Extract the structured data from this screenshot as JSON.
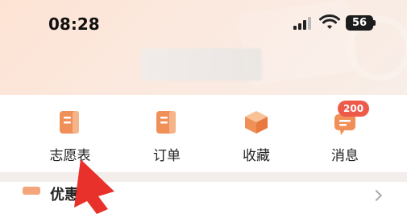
{
  "status_bar": {
    "time": "08:28",
    "battery": "56"
  },
  "menu": [
    {
      "label": "志愿表"
    },
    {
      "label": "订单"
    },
    {
      "label": "收藏"
    },
    {
      "label": "消息"
    }
  ],
  "messages": {
    "badge_count": "200"
  },
  "section": {
    "title": "优惠"
  },
  "colors": {
    "accent": "#f08a4b",
    "badge": "#ee5a4a",
    "header_bg": "#fde3d4",
    "pointer": "#e8312b"
  }
}
